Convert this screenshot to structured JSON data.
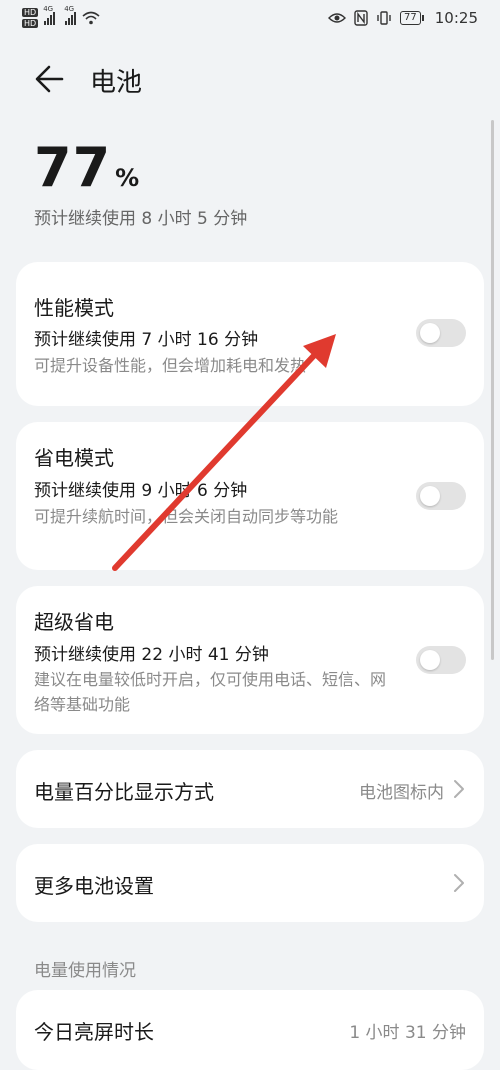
{
  "status_bar": {
    "hd1": "HD",
    "hd2": "HD",
    "net1": "4G",
    "net2": "4G",
    "battery_level": "77",
    "time": "10:25",
    "icons": [
      "eye-icon",
      "nfc-icon",
      "vibrate-icon",
      "battery-icon",
      "wifi-icon"
    ]
  },
  "header": {
    "title": "电池"
  },
  "battery": {
    "percent": "77",
    "unit": "%",
    "remaining": "预计继续使用 8 小时 5 分钟"
  },
  "modes": [
    {
      "title": "性能模式",
      "time": "预计继续使用 7 小时 16 分钟",
      "desc": "可提升设备性能，但会增加耗电和发热",
      "enabled": false
    },
    {
      "title": "省电模式",
      "time": "预计继续使用 9 小时 6 分钟",
      "desc": "可提升续航时间，但会关闭自动同步等功能",
      "enabled": false
    },
    {
      "title": "超级省电",
      "time": "预计继续使用 22 小时 41 分钟",
      "desc": "建议在电量较低时开启，仅可使用电话、短信、网络等基础功能",
      "enabled": false
    }
  ],
  "settings": {
    "percentage_display": {
      "label": "电量百分比显示方式",
      "value": "电池图标内"
    },
    "more": {
      "label": "更多电池设置"
    }
  },
  "usage": {
    "section_title": "电量使用情况",
    "screen_on": {
      "label": "今日亮屏时长",
      "value": "1 小时 31 分钟"
    }
  },
  "annotation_color": "#e03a2f"
}
